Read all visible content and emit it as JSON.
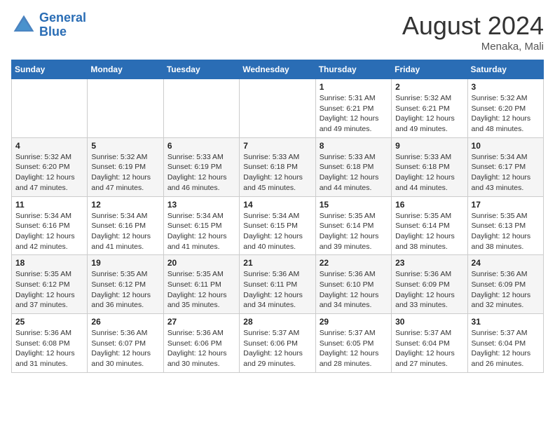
{
  "header": {
    "logo_line1": "General",
    "logo_line2": "Blue",
    "month_year": "August 2024",
    "location": "Menaka, Mali"
  },
  "days_of_week": [
    "Sunday",
    "Monday",
    "Tuesday",
    "Wednesday",
    "Thursday",
    "Friday",
    "Saturday"
  ],
  "weeks": [
    [
      {
        "day": "",
        "info": ""
      },
      {
        "day": "",
        "info": ""
      },
      {
        "day": "",
        "info": ""
      },
      {
        "day": "",
        "info": ""
      },
      {
        "day": "1",
        "info": "Sunrise: 5:31 AM\nSunset: 6:21 PM\nDaylight: 12 hours\nand 49 minutes."
      },
      {
        "day": "2",
        "info": "Sunrise: 5:32 AM\nSunset: 6:21 PM\nDaylight: 12 hours\nand 49 minutes."
      },
      {
        "day": "3",
        "info": "Sunrise: 5:32 AM\nSunset: 6:20 PM\nDaylight: 12 hours\nand 48 minutes."
      }
    ],
    [
      {
        "day": "4",
        "info": "Sunrise: 5:32 AM\nSunset: 6:20 PM\nDaylight: 12 hours\nand 47 minutes."
      },
      {
        "day": "5",
        "info": "Sunrise: 5:32 AM\nSunset: 6:19 PM\nDaylight: 12 hours\nand 47 minutes."
      },
      {
        "day": "6",
        "info": "Sunrise: 5:33 AM\nSunset: 6:19 PM\nDaylight: 12 hours\nand 46 minutes."
      },
      {
        "day": "7",
        "info": "Sunrise: 5:33 AM\nSunset: 6:18 PM\nDaylight: 12 hours\nand 45 minutes."
      },
      {
        "day": "8",
        "info": "Sunrise: 5:33 AM\nSunset: 6:18 PM\nDaylight: 12 hours\nand 44 minutes."
      },
      {
        "day": "9",
        "info": "Sunrise: 5:33 AM\nSunset: 6:18 PM\nDaylight: 12 hours\nand 44 minutes."
      },
      {
        "day": "10",
        "info": "Sunrise: 5:34 AM\nSunset: 6:17 PM\nDaylight: 12 hours\nand 43 minutes."
      }
    ],
    [
      {
        "day": "11",
        "info": "Sunrise: 5:34 AM\nSunset: 6:16 PM\nDaylight: 12 hours\nand 42 minutes."
      },
      {
        "day": "12",
        "info": "Sunrise: 5:34 AM\nSunset: 6:16 PM\nDaylight: 12 hours\nand 41 minutes."
      },
      {
        "day": "13",
        "info": "Sunrise: 5:34 AM\nSunset: 6:15 PM\nDaylight: 12 hours\nand 41 minutes."
      },
      {
        "day": "14",
        "info": "Sunrise: 5:34 AM\nSunset: 6:15 PM\nDaylight: 12 hours\nand 40 minutes."
      },
      {
        "day": "15",
        "info": "Sunrise: 5:35 AM\nSunset: 6:14 PM\nDaylight: 12 hours\nand 39 minutes."
      },
      {
        "day": "16",
        "info": "Sunrise: 5:35 AM\nSunset: 6:14 PM\nDaylight: 12 hours\nand 38 minutes."
      },
      {
        "day": "17",
        "info": "Sunrise: 5:35 AM\nSunset: 6:13 PM\nDaylight: 12 hours\nand 38 minutes."
      }
    ],
    [
      {
        "day": "18",
        "info": "Sunrise: 5:35 AM\nSunset: 6:12 PM\nDaylight: 12 hours\nand 37 minutes."
      },
      {
        "day": "19",
        "info": "Sunrise: 5:35 AM\nSunset: 6:12 PM\nDaylight: 12 hours\nand 36 minutes."
      },
      {
        "day": "20",
        "info": "Sunrise: 5:35 AM\nSunset: 6:11 PM\nDaylight: 12 hours\nand 35 minutes."
      },
      {
        "day": "21",
        "info": "Sunrise: 5:36 AM\nSunset: 6:11 PM\nDaylight: 12 hours\nand 34 minutes."
      },
      {
        "day": "22",
        "info": "Sunrise: 5:36 AM\nSunset: 6:10 PM\nDaylight: 12 hours\nand 34 minutes."
      },
      {
        "day": "23",
        "info": "Sunrise: 5:36 AM\nSunset: 6:09 PM\nDaylight: 12 hours\nand 33 minutes."
      },
      {
        "day": "24",
        "info": "Sunrise: 5:36 AM\nSunset: 6:09 PM\nDaylight: 12 hours\nand 32 minutes."
      }
    ],
    [
      {
        "day": "25",
        "info": "Sunrise: 5:36 AM\nSunset: 6:08 PM\nDaylight: 12 hours\nand 31 minutes."
      },
      {
        "day": "26",
        "info": "Sunrise: 5:36 AM\nSunset: 6:07 PM\nDaylight: 12 hours\nand 30 minutes."
      },
      {
        "day": "27",
        "info": "Sunrise: 5:36 AM\nSunset: 6:06 PM\nDaylight: 12 hours\nand 30 minutes."
      },
      {
        "day": "28",
        "info": "Sunrise: 5:37 AM\nSunset: 6:06 PM\nDaylight: 12 hours\nand 29 minutes."
      },
      {
        "day": "29",
        "info": "Sunrise: 5:37 AM\nSunset: 6:05 PM\nDaylight: 12 hours\nand 28 minutes."
      },
      {
        "day": "30",
        "info": "Sunrise: 5:37 AM\nSunset: 6:04 PM\nDaylight: 12 hours\nand 27 minutes."
      },
      {
        "day": "31",
        "info": "Sunrise: 5:37 AM\nSunset: 6:04 PM\nDaylight: 12 hours\nand 26 minutes."
      }
    ]
  ]
}
